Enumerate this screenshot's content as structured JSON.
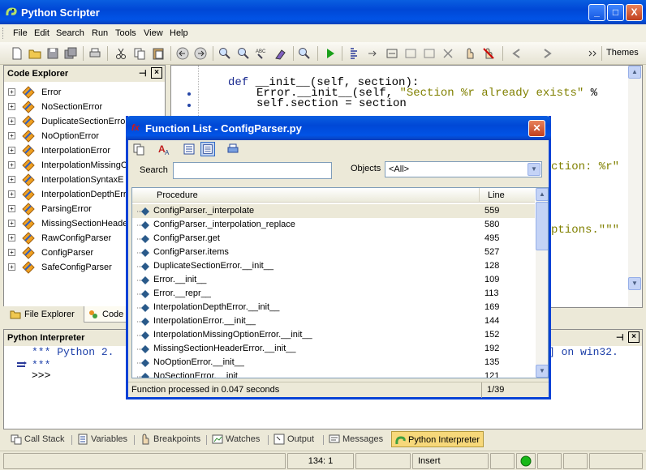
{
  "window": {
    "title": "Python Scripter",
    "buttons": [
      "_",
      "□",
      "X"
    ]
  },
  "menu": [
    "File",
    "Edit",
    "Search",
    "Run",
    "Tools",
    "View",
    "Help"
  ],
  "toolbar": {
    "themes_label": "Themes"
  },
  "code_explorer": {
    "title": "Code Explorer",
    "items": [
      "Error",
      "NoSectionError",
      "DuplicateSectionError",
      "NoOptionError",
      "InterpolationError",
      "InterpolationMissingO",
      "InterpolationSyntaxE",
      "InterpolationDepthErr",
      "ParsingError",
      "MissingSectionHeader",
      "RawConfigParser",
      "ConfigParser",
      "SafeConfigParser"
    ],
    "tabs": [
      "File Explorer",
      "Code"
    ]
  },
  "editor": {
    "lines": [
      {
        "kw": "def ",
        "text": "__init__(self, section):"
      },
      {
        "text": "Error.__init__(self, ",
        "str": "\"Section %r already exists\"",
        "tail": " %"
      },
      {
        "text": "self.section = section"
      }
    ],
    "fragments": [
      "ction: %r\"",
      "ptions.\"\"\""
    ]
  },
  "function_list": {
    "title": "Function List - ConfigParser.py",
    "icon_text": "fx",
    "search_label": "Search",
    "search_value": "",
    "objects_label": "Objects",
    "objects_value": "<All>",
    "columns": {
      "procedure": "Procedure",
      "line": "Line"
    },
    "rows": [
      {
        "procedure": "ConfigParser._interpolate",
        "line": "559"
      },
      {
        "procedure": "ConfigParser._interpolation_replace",
        "line": "580"
      },
      {
        "procedure": "ConfigParser.get",
        "line": "495"
      },
      {
        "procedure": "ConfigParser.items",
        "line": "527"
      },
      {
        "procedure": "DuplicateSectionError.__init__",
        "line": "128"
      },
      {
        "procedure": "Error.__init__",
        "line": "109"
      },
      {
        "procedure": "Error.__repr__",
        "line": "113"
      },
      {
        "procedure": "InterpolationDepthError.__init__",
        "line": "169"
      },
      {
        "procedure": "InterpolationError.__init__",
        "line": "144"
      },
      {
        "procedure": "InterpolationMissingOptionError.__init__",
        "line": "152"
      },
      {
        "procedure": "MissingSectionHeaderError.__init__",
        "line": "192"
      },
      {
        "procedure": "NoOptionError.__init__",
        "line": "135"
      },
      {
        "procedure": "NoSectionError.__init__",
        "line": "121"
      }
    ],
    "status": "Function processed in 0.047 seconds",
    "position": "1/39"
  },
  "interpreter": {
    "title": "Python Interpreter",
    "line1": "*** Python 2.",
    "line1_end": "] on win32.",
    "line2": "***",
    "prompt": ">>>"
  },
  "bottom_tabs": [
    "Call Stack",
    "Variables",
    "Breakpoints",
    "Watches",
    "Output",
    "Messages",
    "Python Interpreter"
  ],
  "status": {
    "position": "134:  1",
    "mode": "Insert"
  }
}
